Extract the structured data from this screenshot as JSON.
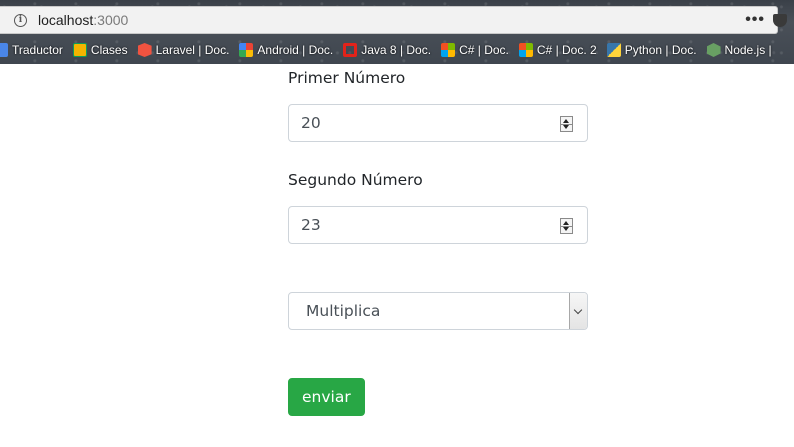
{
  "browser": {
    "url_host": "localhost",
    "url_port": ":3000",
    "menu_glyph": "•••",
    "bookmarks": [
      {
        "label": "Traductor",
        "icon": "translate-icon"
      },
      {
        "label": "Clases",
        "icon": "classroom-icon"
      },
      {
        "label": "Laravel | Doc.",
        "icon": "laravel-icon"
      },
      {
        "label": "Android | Doc.",
        "icon": "google-icon"
      },
      {
        "label": "Java 8 | Doc.",
        "icon": "oracle-icon"
      },
      {
        "label": "C# | Doc.",
        "icon": "microsoft-icon"
      },
      {
        "label": "C# | Doc. 2",
        "icon": "microsoft-icon"
      },
      {
        "label": "Python | Doc.",
        "icon": "python-icon"
      },
      {
        "label": "Node.js |",
        "icon": "nodejs-icon"
      }
    ]
  },
  "form": {
    "first_label": "Primer Número",
    "first_value": "20",
    "second_label": "Segundo Número",
    "second_value": "23",
    "operation_selected": "Multiplica",
    "submit_label": "enviar",
    "submit_color": "#28a745"
  }
}
